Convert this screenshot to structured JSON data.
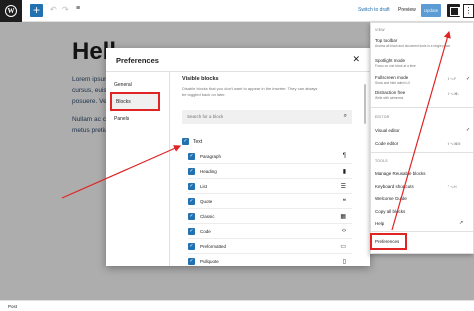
{
  "topbar": {
    "wp_logo": "W",
    "add_icon": "plus-icon",
    "switch_draft": "Switch to draft",
    "preview": "Preview",
    "update": "Update",
    "more_glyph": "⋮"
  },
  "editor": {
    "title": "Hell",
    "lines": [
      "Lorem ipsum",
      "cursus, euis",
      "posuere. Ve",
      "Nullam ac c",
      "metus pretiu"
    ]
  },
  "preferences": {
    "title": "Preferences",
    "close": "✕",
    "tabs": [
      "General",
      "Blocks",
      "Panels"
    ],
    "active_tab": "Blocks",
    "section_title": "Visible blocks",
    "description": "Disable blocks that you don't want to appear in the inserter. They can always be toggled back on later.",
    "search_placeholder": "Search for a block",
    "category": "Text",
    "blocks": [
      {
        "label": "Paragraph",
        "icon": "¶"
      },
      {
        "label": "Heading",
        "icon": "▮"
      },
      {
        "label": "List",
        "icon": "☰"
      },
      {
        "label": "Quote",
        "icon": "❝"
      },
      {
        "label": "Classic",
        "icon": "▦"
      },
      {
        "label": "Code",
        "icon": "‹›"
      },
      {
        "label": "Preformatted",
        "icon": "▭"
      },
      {
        "label": "Pullquote",
        "icon": "▯"
      }
    ]
  },
  "menu": {
    "view_section": "VIEW",
    "top_toolbar": "Top toolbar",
    "top_toolbar_desc": "Access all block and document tools in a single place",
    "spotlight": "Spotlight mode",
    "spotlight_desc": "Focus on one block at a time",
    "fullscreen": "Fullscreen mode",
    "fullscreen_desc": "Show and hide admin UI",
    "fullscreen_shortcut": "⇧⌥F",
    "distraction": "Distraction free",
    "distraction_desc": "Write with calmness",
    "distraction_shortcut": "⇧⌥⌘\\",
    "editor_section": "EDITOR",
    "visual_editor": "Visual editor",
    "code_editor": "Code editor",
    "code_shortcut": "⇧⌥⌘M",
    "tools_section": "TOOLS",
    "manage_reusable": "Manage Reusable blocks",
    "keyboard_shortcuts": "Keyboard shortcuts",
    "keyboard_shortcut_key": "⌃⌥H",
    "welcome_guide": "Welcome Guide",
    "copy_all": "Copy all blocks",
    "help": "Help",
    "preferences": "Preferences",
    "check": "✓",
    "external": "↗"
  },
  "status": {
    "post": "Post"
  },
  "colors": {
    "accent": "#2271b1",
    "highlight": "#e02424"
  }
}
